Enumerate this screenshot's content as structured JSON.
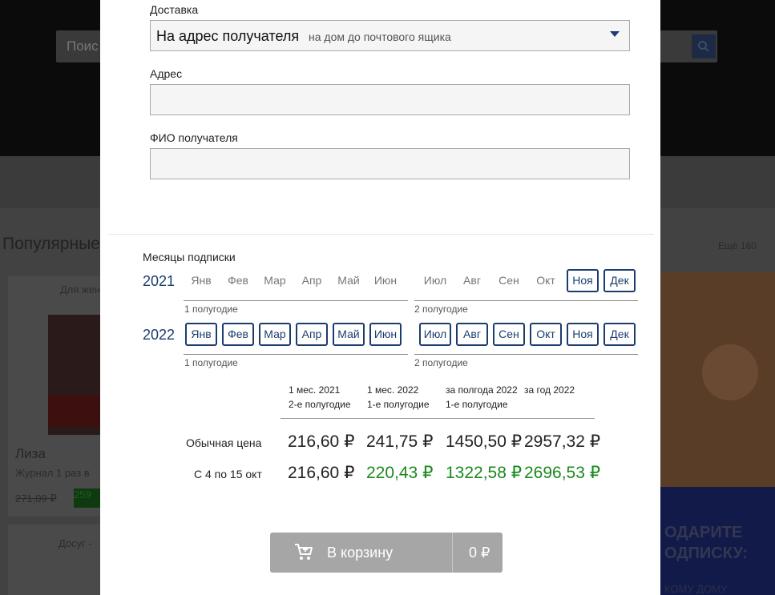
{
  "background": {
    "search_placeholder": "Поис",
    "section_title": "Популярные",
    "more_link": "Ещё 160",
    "card1": {
      "category": "Для жен",
      "title": "Лиза",
      "subtitle": "Журнал 1 раз в",
      "old_price": "271,09 ₽",
      "price": "259"
    },
    "card2": {
      "category": "Досуг - "
    },
    "promo": {
      "line1": "ОДАРИТЕ",
      "line2": "ОДПИСКУ:",
      "line3": "КОМУ ДОМУ"
    }
  },
  "delivery": {
    "label": "Доставка",
    "selected": "На адрес получателя",
    "hint": "на дом до почтового ящика"
  },
  "address": {
    "label": "Адрес",
    "value": ""
  },
  "recipient": {
    "label": "ФИО получателя",
    "value": ""
  },
  "subscription": {
    "label": "Месяцы подписки",
    "years": [
      {
        "year": "2021",
        "months": [
          {
            "label": "Янв",
            "selected": false
          },
          {
            "label": "Фев",
            "selected": false
          },
          {
            "label": "Мар",
            "selected": false
          },
          {
            "label": "Апр",
            "selected": false
          },
          {
            "label": "Май",
            "selected": false
          },
          {
            "label": "Июн",
            "selected": false
          },
          {
            "label": "Июл",
            "selected": false
          },
          {
            "label": "Авг",
            "selected": false
          },
          {
            "label": "Сен",
            "selected": false
          },
          {
            "label": "Окт",
            "selected": false
          },
          {
            "label": "Ноя",
            "selected": true
          },
          {
            "label": "Дек",
            "selected": true
          }
        ],
        "half1": "1 полугодие",
        "half2": "2 полугодие"
      },
      {
        "year": "2022",
        "months": [
          {
            "label": "Янв",
            "selected": true
          },
          {
            "label": "Фев",
            "selected": true
          },
          {
            "label": "Мар",
            "selected": true
          },
          {
            "label": "Апр",
            "selected": true
          },
          {
            "label": "Май",
            "selected": true
          },
          {
            "label": "Июн",
            "selected": true
          },
          {
            "label": "Июл",
            "selected": true
          },
          {
            "label": "Авг",
            "selected": true
          },
          {
            "label": "Сен",
            "selected": true
          },
          {
            "label": "Окт",
            "selected": true
          },
          {
            "label": "Ноя",
            "selected": true
          },
          {
            "label": "Дек",
            "selected": true
          }
        ],
        "half1": "1 полугодие",
        "half2": "2 полугодие"
      }
    ]
  },
  "prices": {
    "columns": [
      {
        "line1": "1 мес. 2021",
        "line2": "2-е полугодие"
      },
      {
        "line1": "1 мес. 2022",
        "line2": "1-е полугодие"
      },
      {
        "line1": "за полгода 2022",
        "line2": "1-е полугодие"
      },
      {
        "line1": "за год 2022",
        "line2": ""
      }
    ],
    "rows": [
      {
        "label": "Обычная цена",
        "values": [
          "216,60 ₽",
          "241,75 ₽",
          "1450,50 ₽",
          "2957,32 ₽"
        ]
      },
      {
        "label": "С 4 по 15 окт",
        "values": [
          "216,60 ₽",
          "220,43 ₽",
          "1322,58 ₽",
          "2696,53 ₽"
        ]
      }
    ]
  },
  "colors": {
    "accent": "#1b3d6e",
    "discount": "#198a1d",
    "button": "#a6a6a6"
  },
  "cart": {
    "label": "В корзину",
    "total": "0 ₽",
    "icon": "cart-icon"
  }
}
